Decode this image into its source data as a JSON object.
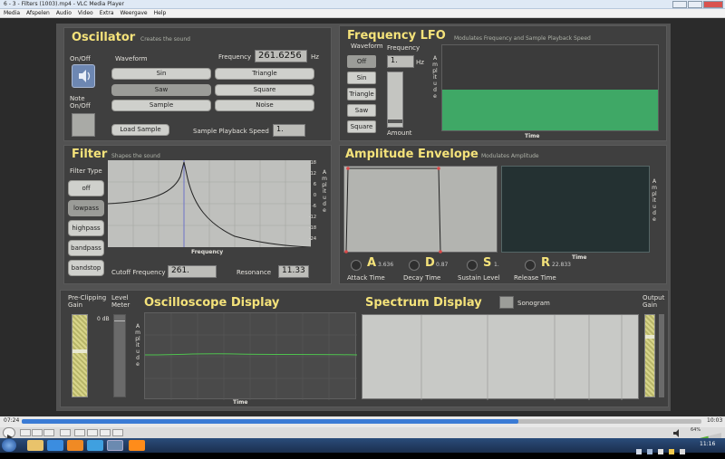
{
  "window": {
    "title": "6 - 3 - Filters (1003).mp4 - VLC Media Player"
  },
  "menu": [
    "Media",
    "Afspelen",
    "Audio",
    "Video",
    "Extra",
    "Weergave",
    "Help"
  ],
  "oscillator": {
    "title": "Oscillator",
    "subtitle": "Creates the sound",
    "onoff_label": "On/Off",
    "note_onoff_label": "Note On/Off",
    "waveform_label": "Waveform",
    "frequency_label": "Frequency",
    "frequency_value": "261.6256",
    "hz": "Hz",
    "waveforms": [
      "Sin",
      "Triangle",
      "Saw",
      "Square",
      "Sample",
      "Noise"
    ],
    "load_sample": "Load Sample",
    "playback_label": "Sample Playback Speed",
    "playback_value": "1."
  },
  "lfo": {
    "title": "Frequency LFO",
    "subtitle": "Modulates Frequency and Sample Playback Speed",
    "waveform_label": "Waveform",
    "frequency_label": "Frequency",
    "frequency_value": "1.",
    "hz": "Hz",
    "buttons": [
      "Off",
      "Sin",
      "Triangle",
      "Saw",
      "Square"
    ],
    "amount_label": "Amount",
    "amplitude_label": "Amplitude",
    "time_label": "Time",
    "color": "#3fa866",
    "level": 0.48
  },
  "filter": {
    "title": "Filter",
    "subtitle": "Shapes the sound",
    "type_label": "Filter Type",
    "types": [
      "off",
      "lowpass",
      "highpass",
      "bandpass",
      "bandstop"
    ],
    "ticks": [
      "18",
      "12",
      "6",
      "0",
      "-6",
      "-12",
      "-18",
      "-24"
    ],
    "amplitude_label": "Amplitude",
    "frequency_axis": "Frequency",
    "cutoff_label": "Cutoff Frequency",
    "cutoff_value": "261.",
    "resonance_label": "Resonance",
    "resonance_value": "11.33"
  },
  "envelope": {
    "title": "Amplitude Envelope",
    "subtitle": "Modulates Amplitude",
    "amplitude_label": "Amplitude",
    "time_label": "Time",
    "adsr": [
      {
        "letter": "A",
        "value": "3.636",
        "label": "Attack Time"
      },
      {
        "letter": "D",
        "value": "0.87",
        "label": "Decay Time"
      },
      {
        "letter": "S",
        "value": "1.",
        "label": "Sustain Level"
      },
      {
        "letter": "R",
        "value": "22.833",
        "label": "Release Time"
      }
    ]
  },
  "bottom": {
    "preclip_label": "Pre-Clipping Gain",
    "level_label": "Level Meter",
    "db_label": "0 dB",
    "oscilloscope_title": "Oscilloscope Display",
    "amplitude_label": "Amplitude",
    "time_label": "Time",
    "spectrum_title": "Spectrum Display",
    "sonogram_label": "Sonogram",
    "output_label": "Output Gain",
    "wave_color": "#4fc24f"
  },
  "player": {
    "elapsed": "07:24",
    "total": "10:03",
    "volume": "64%",
    "progress": 0.73
  },
  "taskbar": {
    "time": "11:16"
  }
}
